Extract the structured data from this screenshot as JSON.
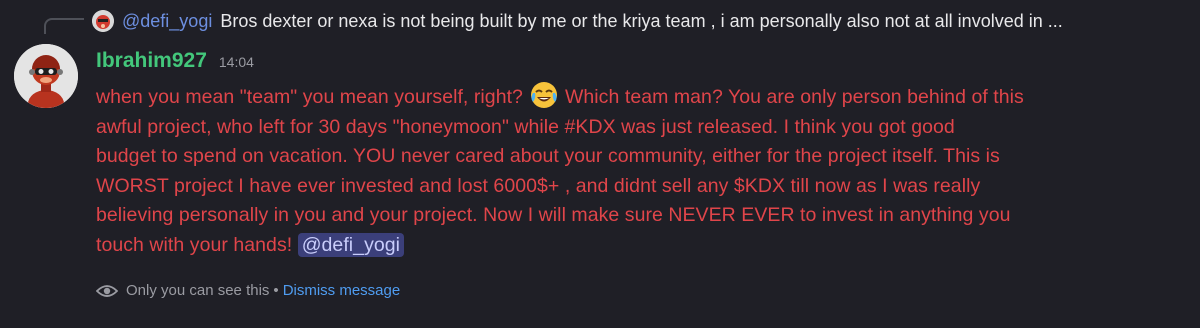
{
  "reply": {
    "author": "@defi_yogi",
    "text": "Bros dexter or nexa is not being built by me or the kriya team , i am personally also not at all involved in ..."
  },
  "message": {
    "username": "Ibrahim927",
    "timestamp": "14:04",
    "lines": [
      "when you mean \"team\" you mean yourself, right?",
      "Which team man? You are only person behind of this",
      "awful project, who left for 30 days \"honeymoon\" while #KDX was just released. I think you got good",
      "budget to spend on vacation. YOU never cared about your community, either for the project itself. This is",
      "WORST project I have ever invested and lost 6000$+ , and didnt sell any $KDX till now as I was really",
      "believing personally in you and your project. Now I will make sure NEVER EVER to invest in anything you",
      "touch with your hands!"
    ],
    "mention": "@defi_yogi",
    "emoji": "joy-emoji"
  },
  "ephemeral": {
    "notice": "Only you can see this",
    "separator": "•",
    "dismiss_label": "Dismiss message"
  },
  "colors": {
    "background": "#1f1f26",
    "message_text": "#e0454a",
    "username": "#43c77b",
    "reply_author": "#6d8fe0",
    "mention_bg": "#3b3f7a",
    "dismiss_link": "#4f9cf0"
  }
}
